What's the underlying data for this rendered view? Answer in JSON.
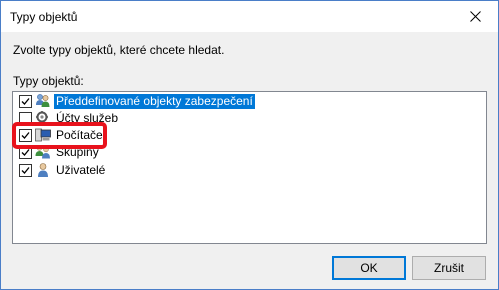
{
  "window": {
    "title": "Typy objektů"
  },
  "prompt": "Zvolte typy objektů, které chcete hledat.",
  "list_label": "Typy objektů:",
  "items": [
    {
      "label": "Předdefinované objekty zabezpečení",
      "checked": true,
      "selected": true,
      "icon": "security-principals-icon"
    },
    {
      "label": "Účty služeb",
      "checked": false,
      "selected": false,
      "icon": "service-accounts-icon"
    },
    {
      "label": "Počítače",
      "checked": true,
      "selected": false,
      "icon": "computer-icon"
    },
    {
      "label": "Skupiny",
      "checked": true,
      "selected": false,
      "icon": "group-icon"
    },
    {
      "label": "Uživatelé",
      "checked": true,
      "selected": false,
      "icon": "user-icon"
    }
  ],
  "buttons": {
    "ok": "OK",
    "cancel": "Zrušit"
  },
  "colors": {
    "selection": "#0078d7",
    "highlight_frame": "#e8121c",
    "window_border": "#4a7ec8"
  }
}
